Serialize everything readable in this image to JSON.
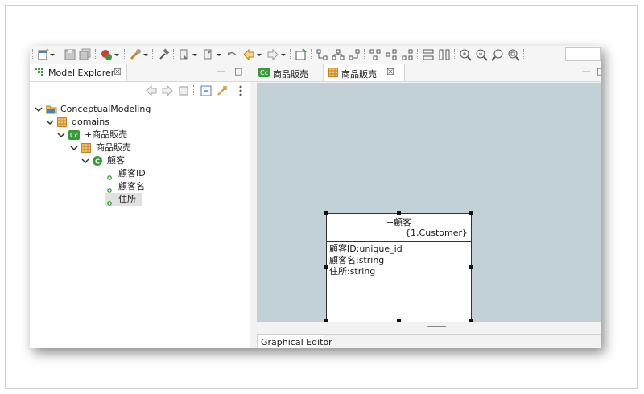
{
  "explorer": {
    "tab_title": "Model Explorer",
    "tree": [
      {
        "label": "ConceptualModeling",
        "icon": "project-icon"
      },
      {
        "label": "domains",
        "icon": "package-icon"
      },
      {
        "label": "+商品販売",
        "icon": "conceptual-model-icon"
      },
      {
        "label": "商品販売",
        "icon": "package-icon"
      },
      {
        "label": "顧客",
        "icon": "class-icon"
      },
      {
        "label": "顧客ID",
        "icon": "attribute-icon"
      },
      {
        "label": "顧客名",
        "icon": "attribute-icon"
      },
      {
        "label": "住所",
        "icon": "attribute-icon"
      }
    ]
  },
  "editor": {
    "tabs": [
      {
        "label": "商品販売",
        "icon": "conceptual-model-icon"
      },
      {
        "label": "商品販売",
        "icon": "package-icon"
      }
    ],
    "bottom_tab": "Graphical Editor"
  },
  "class_box": {
    "name": "+顧客",
    "constraint": "{1,Customer}",
    "attributes": [
      "顧客ID:unique_id",
      "顧客名:string",
      "住所:string"
    ]
  },
  "colors": {
    "canvas": "#c1d1d6",
    "package": "#c8802a",
    "class": "#3a9a3a"
  }
}
